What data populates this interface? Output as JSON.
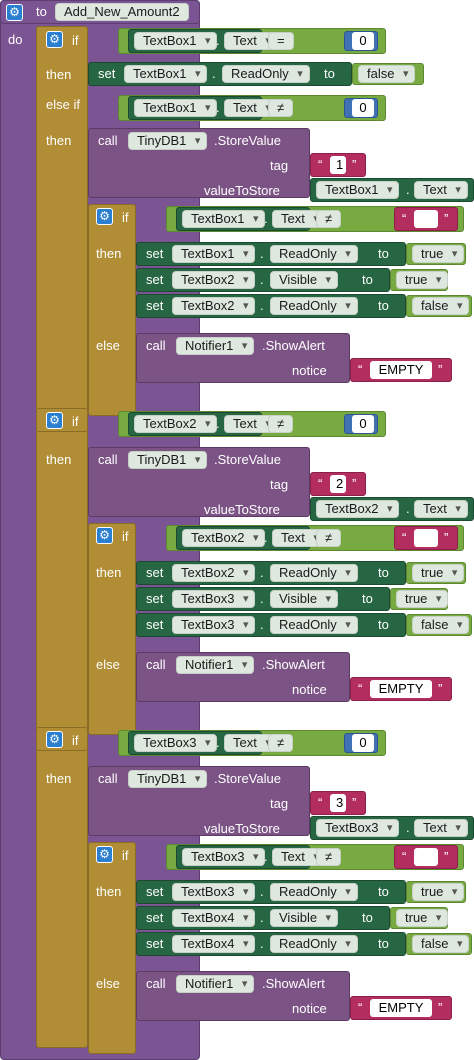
{
  "procedure": {
    "keyword_to": "to",
    "name": "Add_New_Amount2",
    "keyword_do": "do"
  },
  "kw": {
    "if": "if",
    "then": "then",
    "else": "else",
    "else_if": "else if",
    "set": "set",
    "to": "to",
    "call": "call",
    "tag": "tag",
    "value_to_store": "valueToStore",
    "notice": "notice",
    "eq": "=",
    "neq": "≠",
    "dot": "."
  },
  "components": {
    "tb1": "TextBox1",
    "tb2": "TextBox2",
    "tb3": "TextBox3",
    "tb4": "TextBox4",
    "tinydb": "TinyDB1",
    "notifier": "Notifier1"
  },
  "props": {
    "text": "Text",
    "readonly": "ReadOnly",
    "visible": "Visible"
  },
  "methods": {
    "store": ".StoreValue",
    "alert": ".ShowAlert"
  },
  "values": {
    "zero": "0",
    "false": "false",
    "true": "true",
    "tag1": "1",
    "tag2": "2",
    "tag3": "3",
    "empty_msg": "EMPTY",
    "empty_str": ""
  },
  "colors": {
    "procedure": "#7b5593",
    "control": "#b18e35",
    "component_call": "#7c5385",
    "component_set": "#266643",
    "math": "#3f71b5",
    "logic": "#77ab41",
    "text": "#b32d5e"
  }
}
